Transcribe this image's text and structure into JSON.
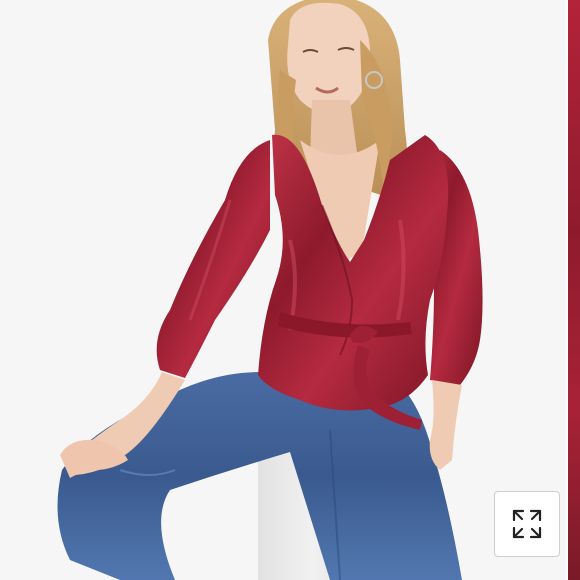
{
  "product_image": {
    "subject": "model-wearing-velvet-wrap-top",
    "garment_color": "#9b1c30",
    "jeans_color": "#3f5f97",
    "background_color": "#f6f6f6"
  },
  "controls": {
    "expand_icon": "expand-arrows-icon"
  }
}
